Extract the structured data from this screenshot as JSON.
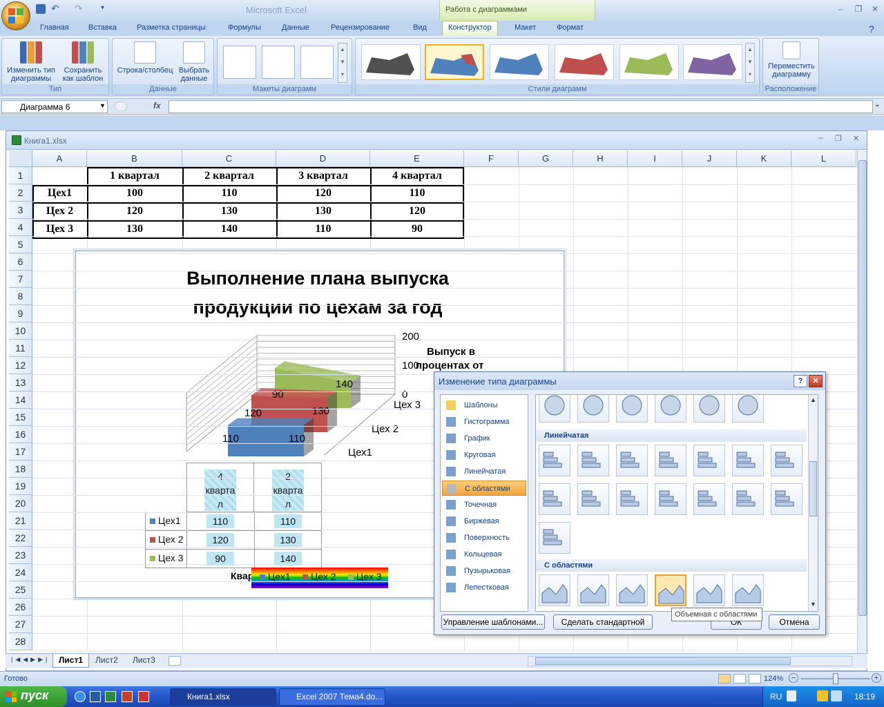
{
  "app": {
    "title": "Microsoft Excel",
    "context_tab_title": "Работа с диаграммами",
    "ribbon_tabs": [
      "Главная",
      "Вставка",
      "Разметка страницы",
      "Формулы",
      "Данные",
      "Рецензирование",
      "Вид",
      "Конструктор",
      "Макет",
      "Формат"
    ],
    "active_tab": "Конструктор"
  },
  "ribbon": {
    "groups": {
      "type": {
        "label": "Тип",
        "btn1": "Изменить тип диаграммы",
        "btn2": "Сохранить как шаблон"
      },
      "data": {
        "label": "Данные",
        "btn1": "Строка/столбец",
        "btn2": "Выбрать данные"
      },
      "layouts": {
        "label": "Макеты диаграмм"
      },
      "styles": {
        "label": "Стили диаграмм",
        "colors": [
          "#505050",
          "#4f81bd",
          "#4f81bd",
          "#c0504d",
          "#9bbb59",
          "#8064a2"
        ],
        "selected_index": 1
      },
      "location": {
        "label": "Расположение",
        "btn1": "Переместить диаграмму"
      }
    }
  },
  "formula_bar": {
    "name_box": "Диаграмма 6",
    "fx": "fx",
    "formula": ""
  },
  "workbook": {
    "title": "Книга1.xlsx",
    "columns": [
      "A",
      "B",
      "C",
      "D",
      "E",
      "F",
      "G",
      "H",
      "I",
      "J",
      "K",
      "L"
    ],
    "rows": [
      "1",
      "2",
      "3",
      "4",
      "5",
      "6",
      "7",
      "8",
      "9",
      "10",
      "11",
      "12",
      "13",
      "14",
      "15",
      "16",
      "17",
      "18",
      "19",
      "20",
      "21",
      "22",
      "23",
      "24",
      "25",
      "26",
      "27",
      "28"
    ],
    "table": {
      "headers": [
        "1 квартал",
        "2 квартал",
        "3 квартал",
        "4 квартал"
      ],
      "rows": [
        {
          "label": "Цех1",
          "values": [
            "100",
            "110",
            "120",
            "110"
          ]
        },
        {
          "label": "Цех 2",
          "values": [
            "120",
            "130",
            "130",
            "120"
          ]
        },
        {
          "label": "Цех 3",
          "values": [
            "130",
            "140",
            "110",
            "90"
          ]
        }
      ]
    },
    "sheet_tabs": [
      "Лист1",
      "Лист2",
      "Лист3"
    ],
    "active_sheet": "Лист1"
  },
  "chart": {
    "title_line1": "Выполнение плана выпуска",
    "title_line2": "продукции по цехам за год",
    "axis_ticks": [
      "200",
      "100",
      "0"
    ],
    "axis_title_line1": "Выпуск в",
    "axis_title_line2": "процентах от",
    "depth_labels": [
      "Цех 3",
      "Цех 2",
      "Цех1"
    ],
    "data_labels": {
      "tsex3": [
        "140",
        "90"
      ],
      "tsex2": [
        "130",
        "120"
      ],
      "tsex1": [
        "110",
        "110"
      ]
    },
    "data_table": {
      "col_headers": [
        "4 кварта л",
        "2 кварта л"
      ],
      "rows": [
        {
          "name": "Цех1",
          "color": "#4f81bd",
          "values": [
            "110",
            "110"
          ]
        },
        {
          "name": "Цех 2",
          "color": "#c0504d",
          "values": [
            "120",
            "130"
          ]
        },
        {
          "name": "Цех 3",
          "color": "#9bbb59",
          "values": [
            "90",
            "140"
          ]
        }
      ]
    },
    "legend_partial": "Квар",
    "legend": [
      "Цех1",
      "Цех 2",
      "Цех 3"
    ]
  },
  "chart_data": {
    "type": "area",
    "title": "Выполнение плана выпуска продукции по цехам за год",
    "categories": [
      "4 квартал",
      "2 квартал"
    ],
    "series": [
      {
        "name": "Цех1",
        "values": [
          110,
          110
        ]
      },
      {
        "name": "Цех 2",
        "values": [
          120,
          130
        ]
      },
      {
        "name": "Цех 3",
        "values": [
          90,
          140
        ]
      }
    ],
    "ylim": [
      0,
      200
    ],
    "ylabel": "Выпуск в процентах от"
  },
  "dialog": {
    "title": "Изменение типа диаграммы",
    "categories": [
      "Шаблоны",
      "Гистограмма",
      "График",
      "Круговая",
      "Линейчатая",
      "С областями",
      "Точечная",
      "Биржевая",
      "Поверхность",
      "Кольцевая",
      "Пузырьковая",
      "Лепестковая"
    ],
    "selected_category": "С областями",
    "section_bar": "Линейчатая",
    "section_area": "С областями",
    "tooltip": "Объемная с областями",
    "buttons": {
      "manage": "Управление шаблонами...",
      "default": "Сделать стандартной",
      "ok": "ОК",
      "cancel": "Отмена"
    }
  },
  "status": {
    "ready": "Готово",
    "zoom": "124%"
  },
  "taskbar": {
    "start": "пуск",
    "tasks": [
      "Книга1.xlsx",
      "Excel 2007 Тема4.do..."
    ],
    "lang": "RU",
    "clock": "18:19"
  }
}
